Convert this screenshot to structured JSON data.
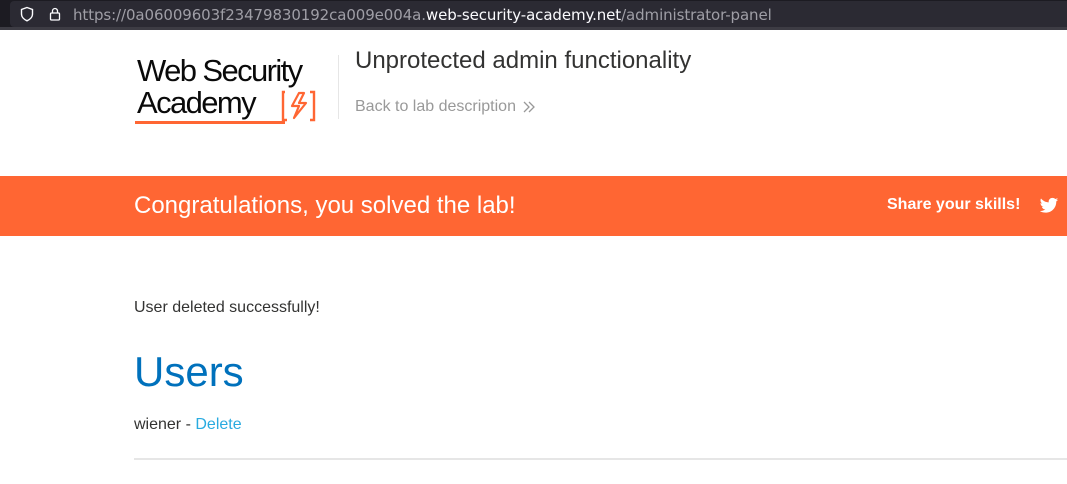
{
  "browser": {
    "url_prefix": "https://0a06009603f23479830192ca009e004a.",
    "url_host": "web-security-academy.net",
    "url_path": "/administrator-panel",
    "shield_icon": "shield-icon",
    "lock_icon": "lock-icon"
  },
  "header": {
    "logo_line1": "Web Security",
    "logo_line2": "Academy",
    "lab_title": "Unprotected admin functionality",
    "back_link": "Back to lab description",
    "back_icon": "double-chevron-right-icon"
  },
  "banner": {
    "message": "Congratulations, you solved the lab!",
    "share_label": "Share your skills!",
    "share_icon": "twitter-icon",
    "color": "#ff6633"
  },
  "content": {
    "status_message": "User deleted successfully!",
    "heading": "Users",
    "users": [
      {
        "name": "wiener",
        "separator": " - ",
        "action": "Delete"
      }
    ]
  },
  "colors": {
    "brand_orange": "#ff6633",
    "heading_blue": "#0071bc",
    "link_blue": "#29abe0"
  }
}
